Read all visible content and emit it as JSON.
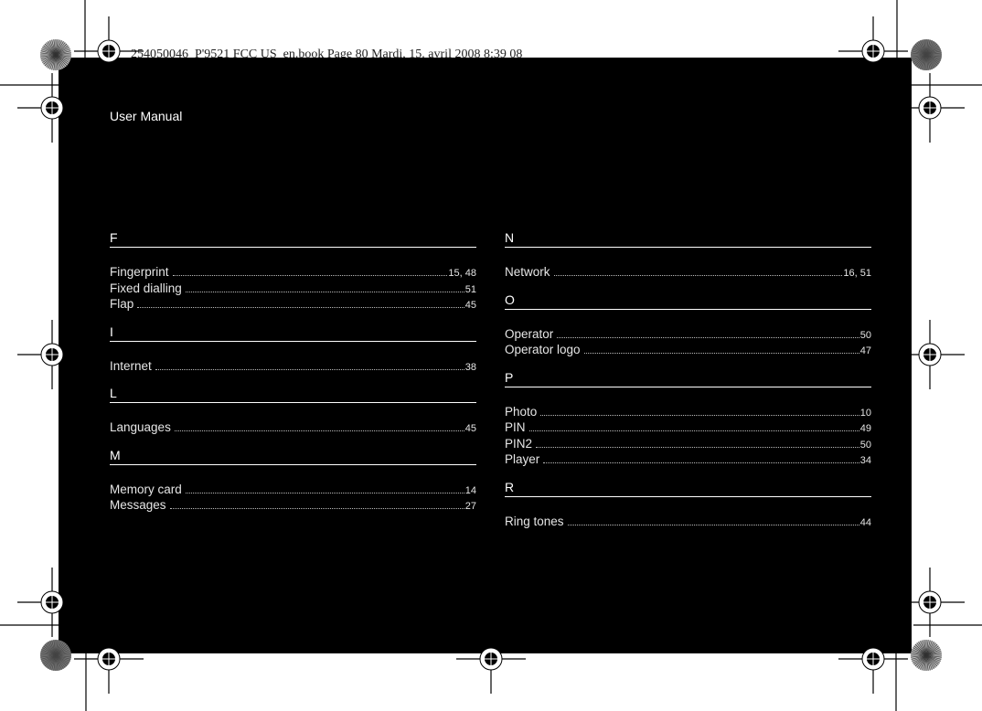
{
  "slug": "254050046_P'9521 FCC US_en.book  Page 80  Mardi, 15. avril 2008  8:39 08",
  "header": {
    "title": "User Manual"
  },
  "index": {
    "left": [
      {
        "letter": "F",
        "entries": [
          {
            "term": "Fingerprint",
            "pages": "15, 48"
          },
          {
            "term": "Fixed dialling",
            "pages": "51"
          },
          {
            "term": "Flap",
            "pages": "45"
          }
        ]
      },
      {
        "letter": "I",
        "entries": [
          {
            "term": "Internet",
            "pages": "38"
          }
        ]
      },
      {
        "letter": "L",
        "entries": [
          {
            "term": "Languages",
            "pages": "45"
          }
        ]
      },
      {
        "letter": "M",
        "entries": [
          {
            "term": "Memory card",
            "pages": "14"
          },
          {
            "term": "Messages",
            "pages": "27"
          }
        ]
      }
    ],
    "right": [
      {
        "letter": "N",
        "entries": [
          {
            "term": "Network",
            "pages": "16, 51"
          }
        ]
      },
      {
        "letter": "O",
        "entries": [
          {
            "term": "Operator",
            "pages": "50"
          },
          {
            "term": "Operator logo",
            "pages": "47"
          }
        ]
      },
      {
        "letter": "P",
        "entries": [
          {
            "term": "Photo",
            "pages": "10"
          },
          {
            "term": "PIN",
            "pages": "49"
          },
          {
            "term": "PIN2",
            "pages": "50"
          },
          {
            "term": "Player",
            "pages": "34"
          }
        ]
      },
      {
        "letter": "R",
        "entries": [
          {
            "term": "Ring tones",
            "pages": "44"
          }
        ]
      }
    ]
  },
  "print_marks": {
    "registration_marks": [
      "top-left",
      "top-right",
      "left-top",
      "left-middle",
      "left-bottom",
      "right-top",
      "right-middle",
      "right-bottom",
      "bottom-left",
      "bottom-center",
      "bottom-right"
    ],
    "color_wheels": [
      "top-left",
      "top-right",
      "bottom-left",
      "bottom-right"
    ]
  }
}
